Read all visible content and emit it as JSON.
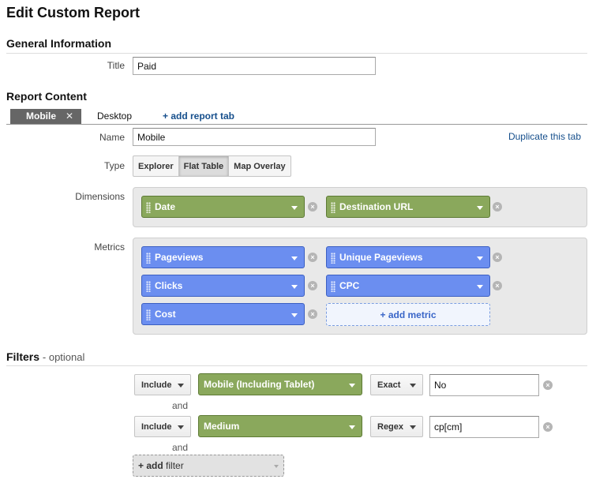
{
  "page": {
    "title": "Edit Custom Report"
  },
  "general": {
    "heading": "General Information",
    "title_label": "Title",
    "title_value": "Paid"
  },
  "content": {
    "heading": "Report Content",
    "tabs": [
      {
        "label": "Mobile",
        "active": true
      },
      {
        "label": "Desktop",
        "active": false
      }
    ],
    "add_tab": "+ add report tab",
    "close_glyph": "✕",
    "name_label": "Name",
    "name_value": "Mobile",
    "duplicate": "Duplicate this tab",
    "type_label": "Type",
    "types": [
      {
        "label": "Explorer",
        "selected": false
      },
      {
        "label": "Flat Table",
        "selected": true
      },
      {
        "label": "Map Overlay",
        "selected": false
      }
    ],
    "dimensions_label": "Dimensions",
    "dimensions": [
      "Date",
      "Destination URL"
    ],
    "metrics_label": "Metrics",
    "metrics": [
      "Pageviews",
      "Unique Pageviews",
      "Clicks",
      "CPC",
      "Cost"
    ],
    "add_metric": "+ add metric"
  },
  "filters": {
    "heading": "Filters",
    "optional": "- optional",
    "rows": [
      {
        "mode": "Include",
        "dimension": "Mobile (Including Tablet)",
        "match": "Exact",
        "value": "No"
      },
      {
        "mode": "Include",
        "dimension": "Medium",
        "match": "Regex",
        "value": "cp[cm]"
      }
    ],
    "and_text": "and",
    "add_filter_prefix": "+ add",
    "add_filter_word": "filter"
  },
  "colors": {
    "dimension_chip": "#8aa85c",
    "metric_chip": "#6b8ef0",
    "link": "#164f8c"
  },
  "icons": {
    "remove": "x-circle-icon",
    "drag": "drag-handle-icon",
    "dropdown": "chevron-down-icon"
  }
}
